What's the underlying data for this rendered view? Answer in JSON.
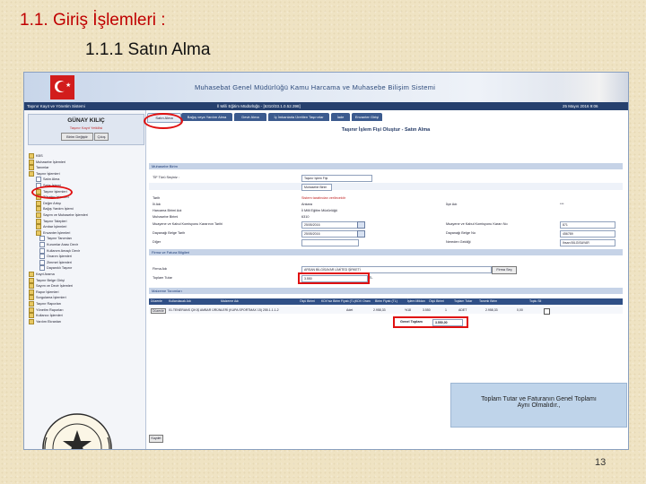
{
  "slide": {
    "title": "1.1. Giriş İşlemleri :",
    "subtitle": "1.1.1  Satın Alma",
    "page_number": "13"
  },
  "banner": {
    "title": "Muhasebat Genel Müdürlüğü Kamu Harcama ve Muhasebe Bilişim Sistemi"
  },
  "navbar": {
    "left": "Taşınır Kayıt ve Yönetim Sistemi",
    "center": "İl Milli Eğitim Müdürlüğü - [6310/33.1.0.52.398]",
    "right": "25 Mayıs 2016 9:06"
  },
  "user": {
    "name": "GÜNAY KILIÇ",
    "school": "Taşınır Kayıt Yetkilisi",
    "change_unit": "Birim Değiştir",
    "exit": "Çıkış"
  },
  "tree": [
    {
      "label": "KBS",
      "type": "folder"
    },
    {
      "label": "Muhasebe İşlemleri",
      "type": "folder"
    },
    {
      "label": "Tanımlar",
      "type": "folder"
    },
    {
      "label": "Taşınır İşlemleri",
      "type": "folder"
    },
    {
      "label": "Satın Alma",
      "type": "doc"
    },
    {
      "label": "Satış İşlemi",
      "type": "doc"
    },
    {
      "label": "Taşınır İşlemleri",
      "type": "folder"
    },
    {
      "label": "Tüketim İşlemleri",
      "type": "folder"
    },
    {
      "label": "Değer Artışı",
      "type": "folder"
    },
    {
      "label": "Bağış Yardım İşlemi",
      "type": "folder"
    },
    {
      "label": "Sayım ve Muhasebe İşlemleri",
      "type": "folder"
    },
    {
      "label": "Taşınır Talepleri",
      "type": "folder"
    },
    {
      "label": "Ambar İşlemleri",
      "type": "folder"
    },
    {
      "label": "Envanter İşlemleri",
      "type": "folder"
    },
    {
      "label": "Taşınır Tanımları",
      "type": "doc"
    },
    {
      "label": "Kurumlar Arası Devir",
      "type": "doc"
    },
    {
      "label": "Kullanım Amaçlı Devir",
      "type": "doc"
    },
    {
      "label": "Onarım İşlemleri",
      "type": "doc"
    },
    {
      "label": "Zimmet İşlemleri",
      "type": "doc"
    },
    {
      "label": "Dayanıklı Taşınır",
      "type": "doc"
    },
    {
      "label": "Kayıt Arama",
      "type": "folder"
    },
    {
      "label": "Taşınır Belge Girişi",
      "type": "folder"
    },
    {
      "label": "Sayım ve Devir İşlemleri",
      "type": "folder"
    },
    {
      "label": "Rapor İşlemleri",
      "type": "folder"
    },
    {
      "label": "Sorgulama İşlemleri",
      "type": "folder"
    },
    {
      "label": "Taşınır Raporları",
      "type": "folder"
    },
    {
      "label": "Yönetim Raporları",
      "type": "folder"
    },
    {
      "label": "Kullanıcı İşlemleri",
      "type": "folder"
    },
    {
      "label": "Yardım Ekranları",
      "type": "folder"
    }
  ],
  "tabs": [
    {
      "label": "Satın Alma",
      "active": true
    },
    {
      "label": "Bağış veya Yardım Alma",
      "active": false
    },
    {
      "label": "Devir Alma",
      "active": false
    },
    {
      "label": "İç İmkanlarla Üretilen Taşınırlar",
      "active": false
    },
    {
      "label": "İade",
      "active": false
    },
    {
      "label": "Envanter Girişi",
      "active": false
    }
  ],
  "form": {
    "title": "Taşınır İşlem Fişi Oluştur - Satın Alma",
    "section1": "Muhasebe Birim",
    "tif_label": "TİF Türü Seçiniz :",
    "tif_value": "Taşınır İşlem Fişi",
    "muhasebe_label": "Muhasebe Birim",
    "tarih_label": "Tarih",
    "tarih_value": "Sistem tarafından verilecektir",
    "il_label": "İli Adı",
    "il_value": "Ankara",
    "ilce_label": "İlçe Adı",
    "ilce_value": "***",
    "harcama_label": "Harcama Birimi Adı",
    "harcama_value": "İl Milli Eğitim Müdürlüğü",
    "muhasebe_kod_label": "Muhasebe Birimi",
    "muhasebe_kod_value": "6310",
    "muayene_label": "Muayene ve Kabul Komisyonu Kararının Tarihi",
    "muayene_value": "25/05/2016",
    "muayene_no_label": "Muayene ve Kabul Komisyonu Kararı No",
    "muayene_no_value": "871",
    "dayanak_label": "Dayanağı Belge Tarih",
    "dayanak_value": "25/05/2016",
    "dayanak_no_label": "Dayanağı Belge No",
    "dayanak_no_value": "456789",
    "diger_label": "Diğer",
    "diger_right_label": "Nereden Geldiği",
    "diger_right_value": "Ihsan BİLGİSAYAR",
    "section2": "Firma ve Fatura Bilgileri",
    "firma_label": "Firma Adı",
    "firma_value": "ARSAN BİLGİSAYAR LİMİTED ŞİRKETİ",
    "firma_btn": "Firma Seç",
    "toplam_label": "Toplam Tutar",
    "toplam_value": "3.550",
    "toplam_unit": "TL",
    "section3": "Malzeme Tanımları",
    "grid_headers": [
      "Düzenle",
      "Kullanılacak Adı",
      "Malzeme Adı",
      "Ölçü Birimi",
      "KDV'siz Birim Fiyatı (TL)",
      "KDV Oranı",
      "Birim Fiyatı (TL)",
      "İşlem Miktarı",
      "Ölçü Birimi",
      "Toplam Tutar",
      "Tanımlı Birim",
      "Toplu Sil"
    ],
    "grid_row": {
      "edit": "Düzenle",
      "name": "01.TENERANS ÇIKIŞ AMBAR ÜRÜNLERİ (KUPA SPORTMAX 15) 255.1.1.1-2",
      "unit": "Adet",
      "price": "2.958,33",
      "kdv": "%18",
      "unit_price": "3.550",
      "qty": "1",
      "measure": "ADET",
      "total": "2.958,33",
      "tanimli": "0,00"
    },
    "genel_toplam_label": "Genel Toplam",
    "genel_toplam_value": "3.550,00",
    "save_btn": "Kaydet"
  },
  "callout": {
    "line1": "Toplam Tutar ve Faturanın Genel Toplamı",
    "line2": "Aynı Olmalıdır.,"
  }
}
